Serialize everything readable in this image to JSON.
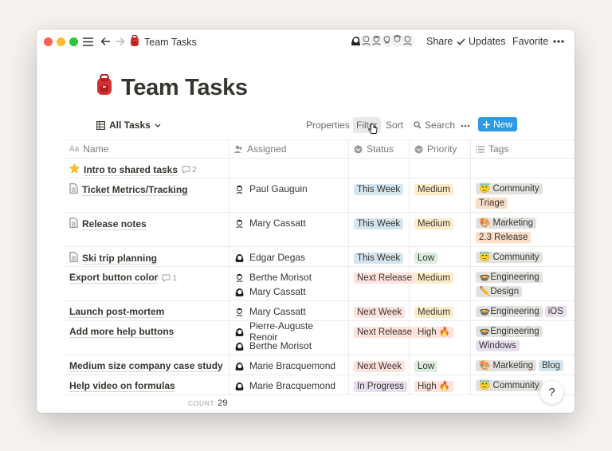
{
  "window": {
    "breadcrumb": "Team Tasks"
  },
  "topbar": {
    "share": "Share",
    "updates": "Updates",
    "favorite": "Favorite"
  },
  "page": {
    "title": "Team Tasks"
  },
  "view": {
    "name": "All Tasks",
    "properties": "Properties",
    "filter": "Filter",
    "sort": "Sort",
    "search": "Search",
    "new": "New"
  },
  "columns": {
    "name": "Name",
    "assigned": "Assigned",
    "status": "Status",
    "priority": "Priority",
    "tags": "Tags"
  },
  "colors": {
    "accent": "#2f9ae0",
    "status": {
      "This Week": "#d3e5ef",
      "Next Release": "#ffe2dd",
      "Next Week": "#ffe2dd",
      "In Progress": "#e8deee"
    },
    "priority": {
      "Medium": "#fdecc8",
      "Low": "#dbeddb",
      "High 🔥": "#ffe2dd"
    },
    "tag": {
      "gray": "#e3e2e0",
      "orange": "#fadec9",
      "purple": "#e8deee",
      "blue": "#d3e5ef"
    }
  },
  "rows": [
    {
      "icon": "star",
      "name": "Intro to shared tasks",
      "comments": "2",
      "assigned": [],
      "status": "",
      "priority": "",
      "tags": []
    },
    {
      "icon": "doc",
      "name": "Ticket Metrics/Tracking",
      "comments": "",
      "assigned": [
        "Paul Gauguin"
      ],
      "status": "This Week",
      "priority": "Medium",
      "tags": [
        {
          "label": "😇 Community",
          "color": "gray"
        },
        {
          "label": "Triage",
          "color": "orange"
        }
      ]
    },
    {
      "icon": "doc",
      "name": "Release notes",
      "comments": "",
      "assigned": [
        "Mary Cassatt"
      ],
      "status": "This Week",
      "priority": "Medium",
      "tags": [
        {
          "label": "🎨 Marketing",
          "color": "gray"
        },
        {
          "label": "2.3 Release",
          "color": "orange"
        }
      ]
    },
    {
      "icon": "doc",
      "name": "Ski trip planning",
      "comments": "",
      "assigned": [
        "Edgar Degas"
      ],
      "status": "This Week",
      "priority": "Low",
      "tags": [
        {
          "label": "😇 Community",
          "color": "gray"
        }
      ]
    },
    {
      "icon": "",
      "name": "Export button color",
      "comments": "1",
      "assigned": [
        "Berthe Morisot",
        "Mary Cassatt"
      ],
      "status": "Next Release",
      "priority": "Medium",
      "tags": [
        {
          "label": "🍲Engineering",
          "color": "gray"
        },
        {
          "label": "✏️Design",
          "color": "gray"
        }
      ]
    },
    {
      "icon": "",
      "name": "Launch post-mortem",
      "comments": "",
      "assigned": [
        "Mary Cassatt"
      ],
      "status": "Next Week",
      "priority": "Medium",
      "tags": [
        {
          "label": "🍲Engineering",
          "color": "gray"
        },
        {
          "label": "iOS",
          "color": "purple"
        }
      ]
    },
    {
      "icon": "",
      "name": "Add more help buttons",
      "comments": "",
      "assigned": [
        "Pierre-Auguste Renoir",
        "Berthe Morisot"
      ],
      "status": "Next Release",
      "priority": "High 🔥",
      "tags": [
        {
          "label": "🍲Engineering",
          "color": "gray"
        },
        {
          "label": "Windows",
          "color": "purple"
        }
      ]
    },
    {
      "icon": "",
      "name": "Medium size company case study",
      "comments": "",
      "assigned": [
        "Marie Bracquemond"
      ],
      "status": "Next Week",
      "priority": "Low",
      "tags": [
        {
          "label": "🎨 Marketing",
          "color": "gray"
        },
        {
          "label": "Blog",
          "color": "blue"
        }
      ]
    },
    {
      "icon": "",
      "name": "Help video on formulas",
      "comments": "",
      "assigned": [
        "Marie Bracquemond"
      ],
      "status": "In Progress",
      "priority": "High 🔥",
      "tags": [
        {
          "label": "😇 Community",
          "color": "gray"
        }
      ]
    }
  ],
  "footer": {
    "count_label": "COUNT",
    "count_value": "29"
  },
  "help": {
    "label": "?"
  }
}
